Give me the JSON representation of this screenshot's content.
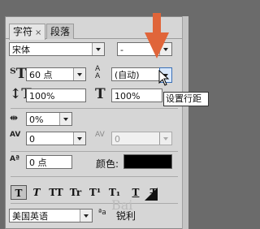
{
  "tabs": [
    {
      "label": "字符",
      "close_glyph": "×"
    },
    {
      "label": "段落"
    }
  ],
  "font": {
    "family": "宋体",
    "style": "-"
  },
  "size": {
    "value": "60 点"
  },
  "leading": {
    "value": "(自动)"
  },
  "vertical_scale": {
    "value": "100%"
  },
  "horizontal_scale": {
    "value": "100%"
  },
  "tracking_ratio": {
    "value": "0%"
  },
  "kerning": {
    "value": "0"
  },
  "tracking": {
    "value": "0"
  },
  "baseline_shift": {
    "value": "0 点"
  },
  "color": {
    "label": "颜色:",
    "swatch": "#000000"
  },
  "style_buttons": [
    "T",
    "T",
    "TT",
    "Tr",
    "T¹",
    "T₁",
    "T",
    "T"
  ],
  "language": {
    "value": "美国英语"
  },
  "antialias": {
    "icon_text": "ªa",
    "value": "锐利"
  },
  "tooltip": {
    "text": "设置行距"
  },
  "watermark": {
    "text": "Bai"
  },
  "colors": {
    "annotation_arrow": "#e0653a",
    "panel": "#d6d6d6",
    "background": "#6b6b6b"
  }
}
